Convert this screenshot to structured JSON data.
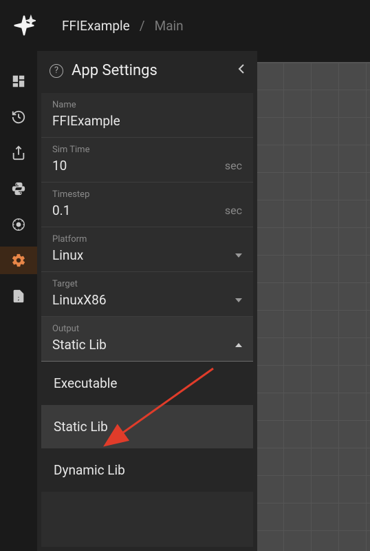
{
  "breadcrumb": {
    "project": "FFIExample",
    "page": "Main"
  },
  "panel": {
    "title": "App Settings"
  },
  "fields": {
    "name": {
      "label": "Name",
      "value": "FFIExample"
    },
    "sim_time": {
      "label": "Sim Time",
      "value": "10",
      "unit": "sec"
    },
    "timestep": {
      "label": "Timestep",
      "value": "0.1",
      "unit": "sec"
    },
    "platform": {
      "label": "Platform",
      "value": "Linux"
    },
    "target": {
      "label": "Target",
      "value": "LinuxX86"
    },
    "output": {
      "label": "Output",
      "value": "Static Lib"
    }
  },
  "output_options": [
    "Executable",
    "Static Lib",
    "Dynamic Lib"
  ]
}
